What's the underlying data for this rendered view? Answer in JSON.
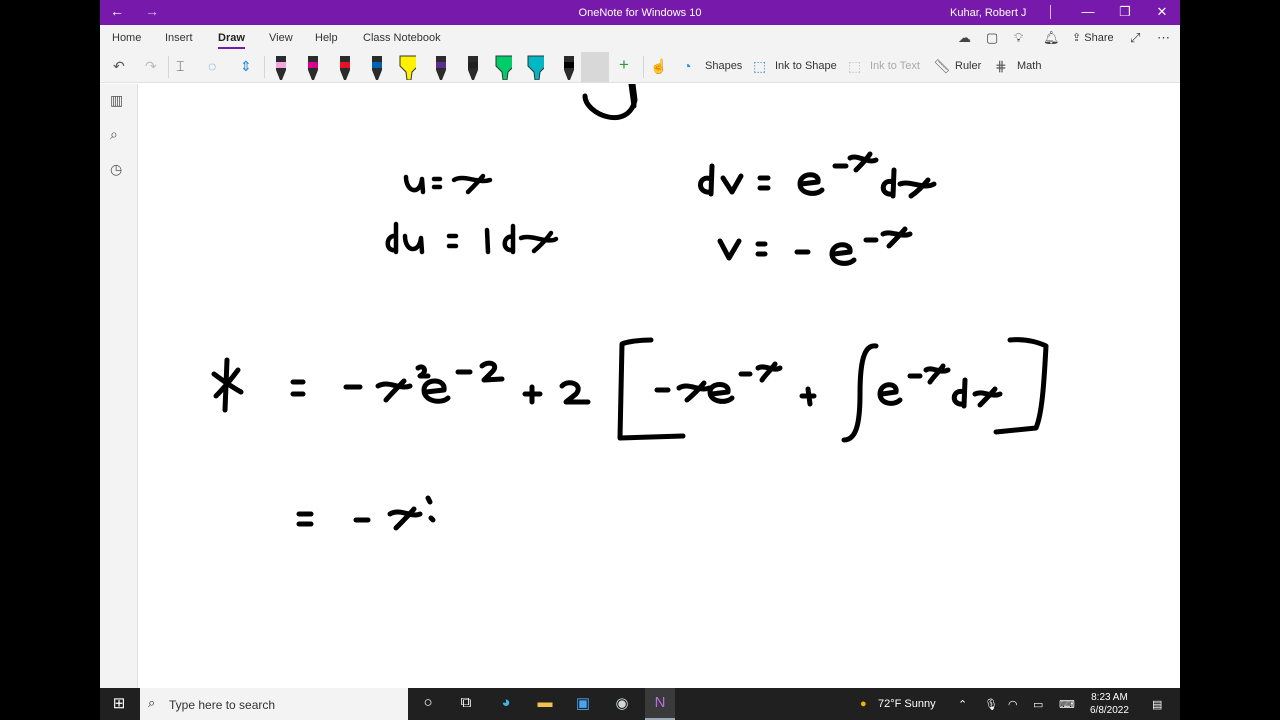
{
  "titlebar": {
    "title": "OneNote for Windows 10",
    "user": "Kuhar, Robert J",
    "back_glyph": "←",
    "forward_glyph": "→",
    "minimize_glyph": "—",
    "restore_glyph": "❐",
    "close_glyph": "✕"
  },
  "ribbon": {
    "tabs": [
      "Home",
      "Insert",
      "Draw",
      "View",
      "Help",
      "Class Notebook"
    ],
    "active_tab": "Draw",
    "share_label": "Share"
  },
  "toolbar": {
    "shapes_label": "Shapes",
    "ink_to_shape_label": "Ink to Shape",
    "ink_to_text_label": "Ink to Text",
    "ruler_label": "Ruler",
    "math_label": "Math",
    "pens": [
      {
        "kind": "pen",
        "color": "#f2a6e0"
      },
      {
        "kind": "pen",
        "color": "#d8008c"
      },
      {
        "kind": "pen",
        "color": "#e81123"
      },
      {
        "kind": "pen",
        "color": "#0063b1"
      },
      {
        "kind": "highlighter",
        "color": "#fff100"
      },
      {
        "kind": "pen",
        "color": "#5c2d91"
      },
      {
        "kind": "pen",
        "color": "#222222"
      },
      {
        "kind": "highlighter",
        "color": "#00cc6a"
      },
      {
        "kind": "highlighter",
        "color": "#00b7c3"
      },
      {
        "kind": "pen",
        "color": "#000000",
        "selected": true
      }
    ]
  },
  "canvas": {
    "ink_text": [
      "u = x",
      "du = 1 dx",
      "dv = e^-x dx",
      "v = -e^-x",
      "* = -x²e^-x + 2[-xe^-x + ∫e^-x dx]",
      "= -x²"
    ]
  },
  "taskbar": {
    "search_placeholder": "Type here to search",
    "weather": "72°F  Sunny",
    "time": "8:23 AM",
    "date": "6/8/2022"
  },
  "colors": {
    "titlebar": "#7719aa",
    "ribbon_bg": "#f3f3f3",
    "taskbar": "#202020"
  }
}
